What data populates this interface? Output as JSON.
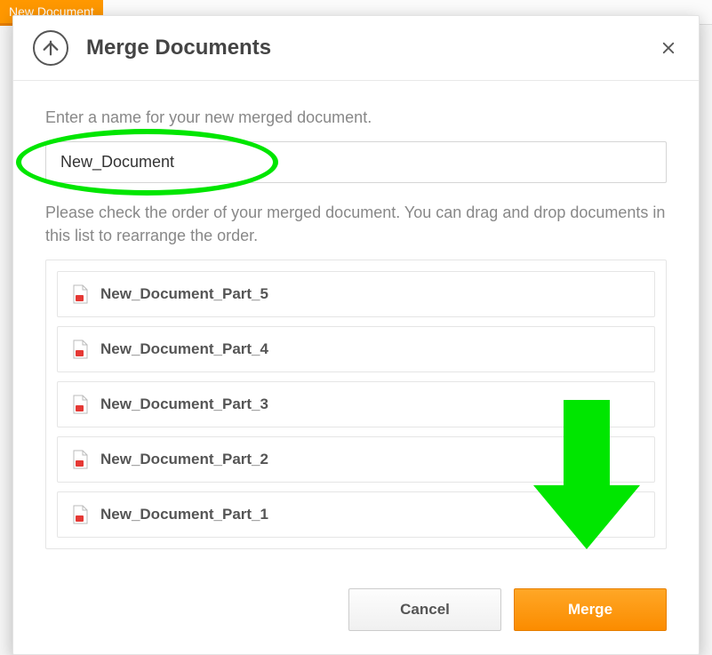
{
  "background": {
    "new_document_label": "New Document"
  },
  "modal": {
    "title": "Merge Documents",
    "instruction_name": "Enter a name for your new merged document.",
    "name_value": "New_Document",
    "instruction_order": "Please check the order of your merged document. You can drag and drop documents in this list to rearrange the order.",
    "items": [
      {
        "label": "New_Document_Part_5"
      },
      {
        "label": "New_Document_Part_4"
      },
      {
        "label": "New_Document_Part_3"
      },
      {
        "label": "New_Document_Part_2"
      },
      {
        "label": "New_Document_Part_1"
      }
    ],
    "cancel_label": "Cancel",
    "merge_label": "Merge"
  }
}
